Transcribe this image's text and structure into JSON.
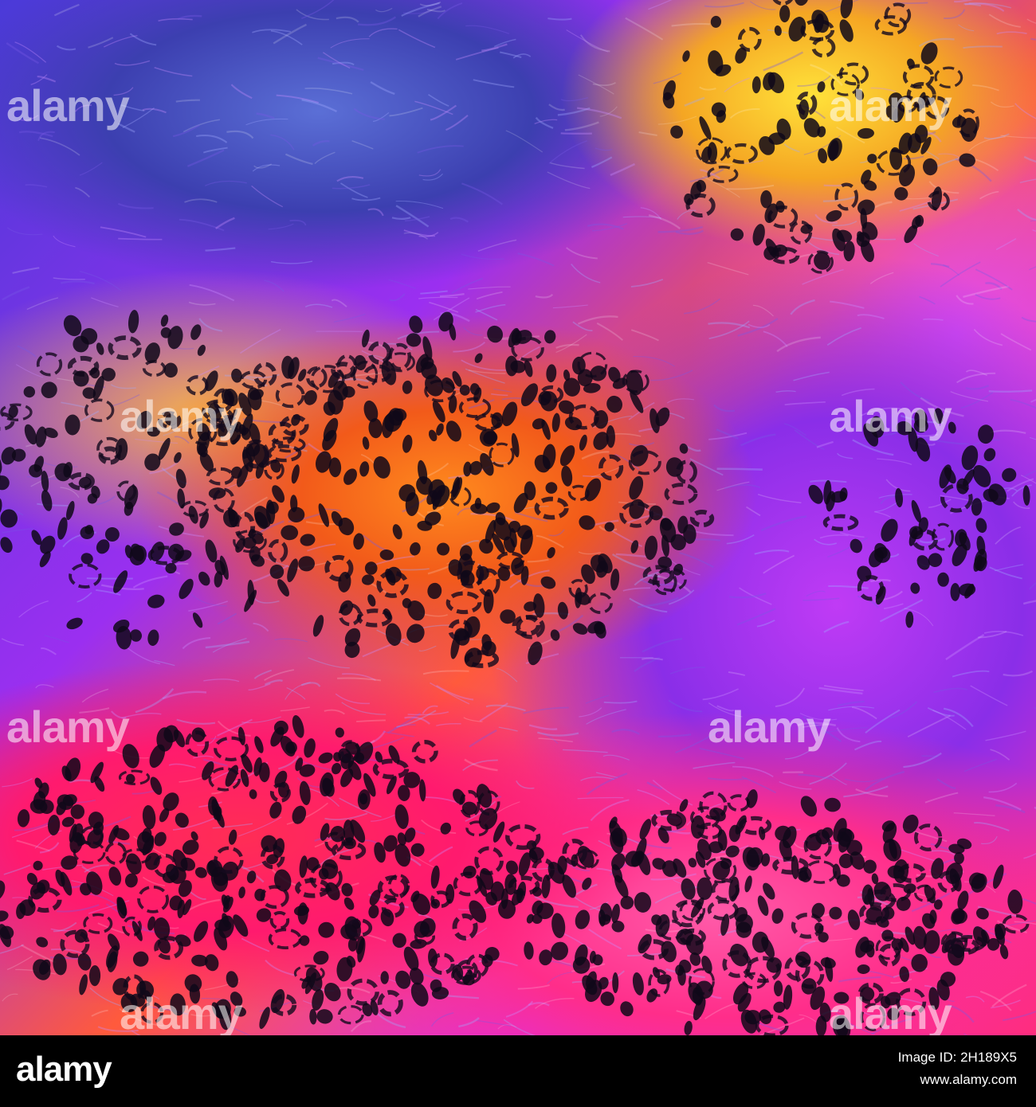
{
  "image": {
    "subject": "colorful leopard print fur pattern",
    "palette": [
      "#4a3ad8",
      "#9b2ff0",
      "#d92ff0",
      "#ff2d7a",
      "#ff8a1e",
      "#ffe23a"
    ]
  },
  "watermark": {
    "text": "alamy"
  },
  "footer": {
    "logo": "alamy",
    "image_id_label": "Image ID: 2H189X5",
    "url": "www.alamy.com"
  }
}
